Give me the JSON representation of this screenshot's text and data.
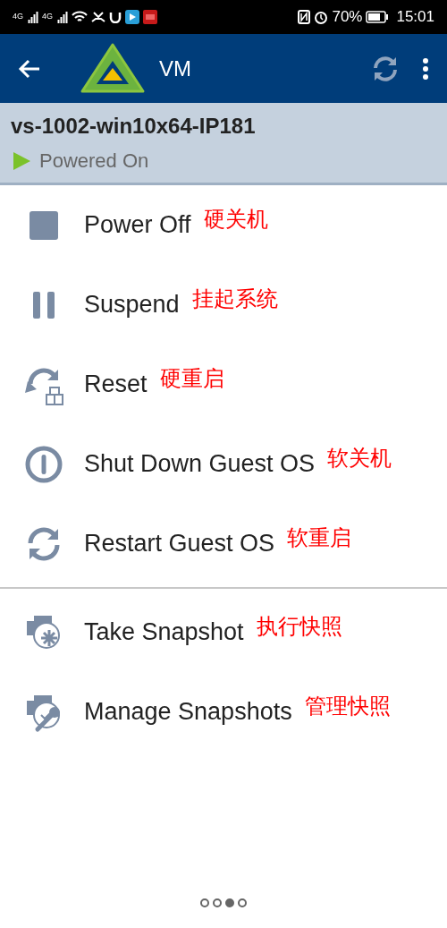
{
  "status_bar": {
    "network_left": "4G",
    "network_right": "4G",
    "battery": "70%",
    "time": "15:01"
  },
  "app_bar": {
    "title": "VM"
  },
  "vm": {
    "name": "vs-1002-win10x64-IP181",
    "state": "Powered On",
    "running": true
  },
  "action_groups": [
    [
      {
        "kind": "power-off",
        "label": "Power Off",
        "note": "硬关机"
      },
      {
        "kind": "suspend",
        "label": "Suspend",
        "note": "挂起系统"
      },
      {
        "kind": "reset",
        "label": "Reset",
        "note": "硬重启"
      },
      {
        "kind": "shutdown",
        "label": "Shut Down Guest OS",
        "note": "软关机"
      },
      {
        "kind": "restart",
        "label": "Restart Guest OS",
        "note": "软重启"
      }
    ],
    [
      {
        "kind": "snapshot",
        "label": "Take Snapshot",
        "note": "执行快照"
      },
      {
        "kind": "manage",
        "label": "Manage Snapshots",
        "note": "管理快照"
      }
    ]
  ],
  "pager": [
    {
      "selected": false
    },
    {
      "selected": false
    },
    {
      "selected": true
    },
    {
      "selected": false
    }
  ]
}
